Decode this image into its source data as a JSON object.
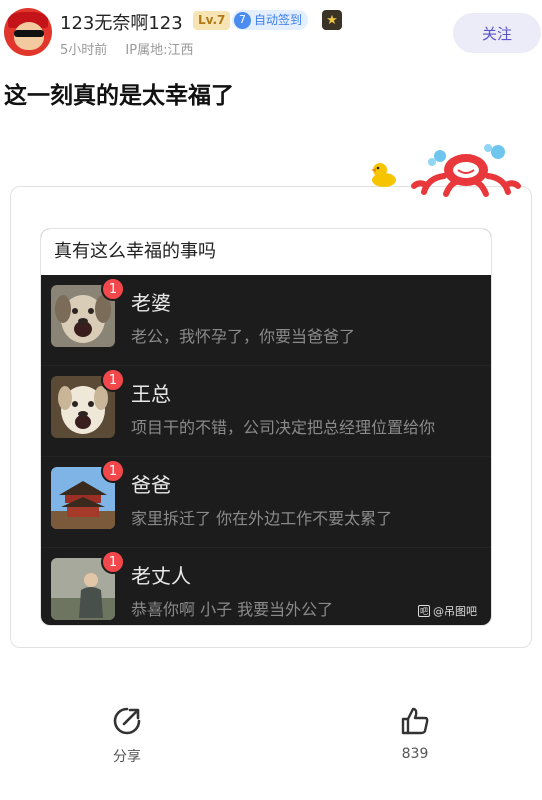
{
  "post": {
    "author": {
      "name": "123无奈啊123",
      "level": "Lv.7",
      "checkin_days": "7",
      "checkin_label": "自动签到"
    },
    "time": "5小时前",
    "location": "IP属地:江西",
    "follow_label": "关注",
    "title": "这一刻真的是太幸福了"
  },
  "image": {
    "header_title": "真有这么幸福的事吗",
    "chats": [
      {
        "name": "老婆",
        "message": "老公，我怀孕了，你要当爸爸了",
        "unread": "1",
        "avatar_icon": "dog-avatar-icon"
      },
      {
        "name": "王总",
        "message": "项目干的不错，公司决定把总经理位置给你",
        "unread": "1",
        "avatar_icon": "dog-avatar-icon"
      },
      {
        "name": "爸爸",
        "message": "家里拆迁了 你在外边工作不要太累了",
        "unread": "1",
        "avatar_icon": "temple-avatar-icon"
      },
      {
        "name": "老丈人",
        "message": "恭喜你啊 小子 我要当外公了",
        "unread": "1",
        "avatar_icon": "person-avatar-icon"
      }
    ],
    "watermark": "@吊图吧"
  },
  "actions": {
    "share_label": "分享",
    "like_count": "839"
  },
  "colors": {
    "accent": "#5b54c8",
    "follow_bg": "#ecebf8",
    "unread": "#f2484b",
    "checkin": "#3b7ee8"
  }
}
